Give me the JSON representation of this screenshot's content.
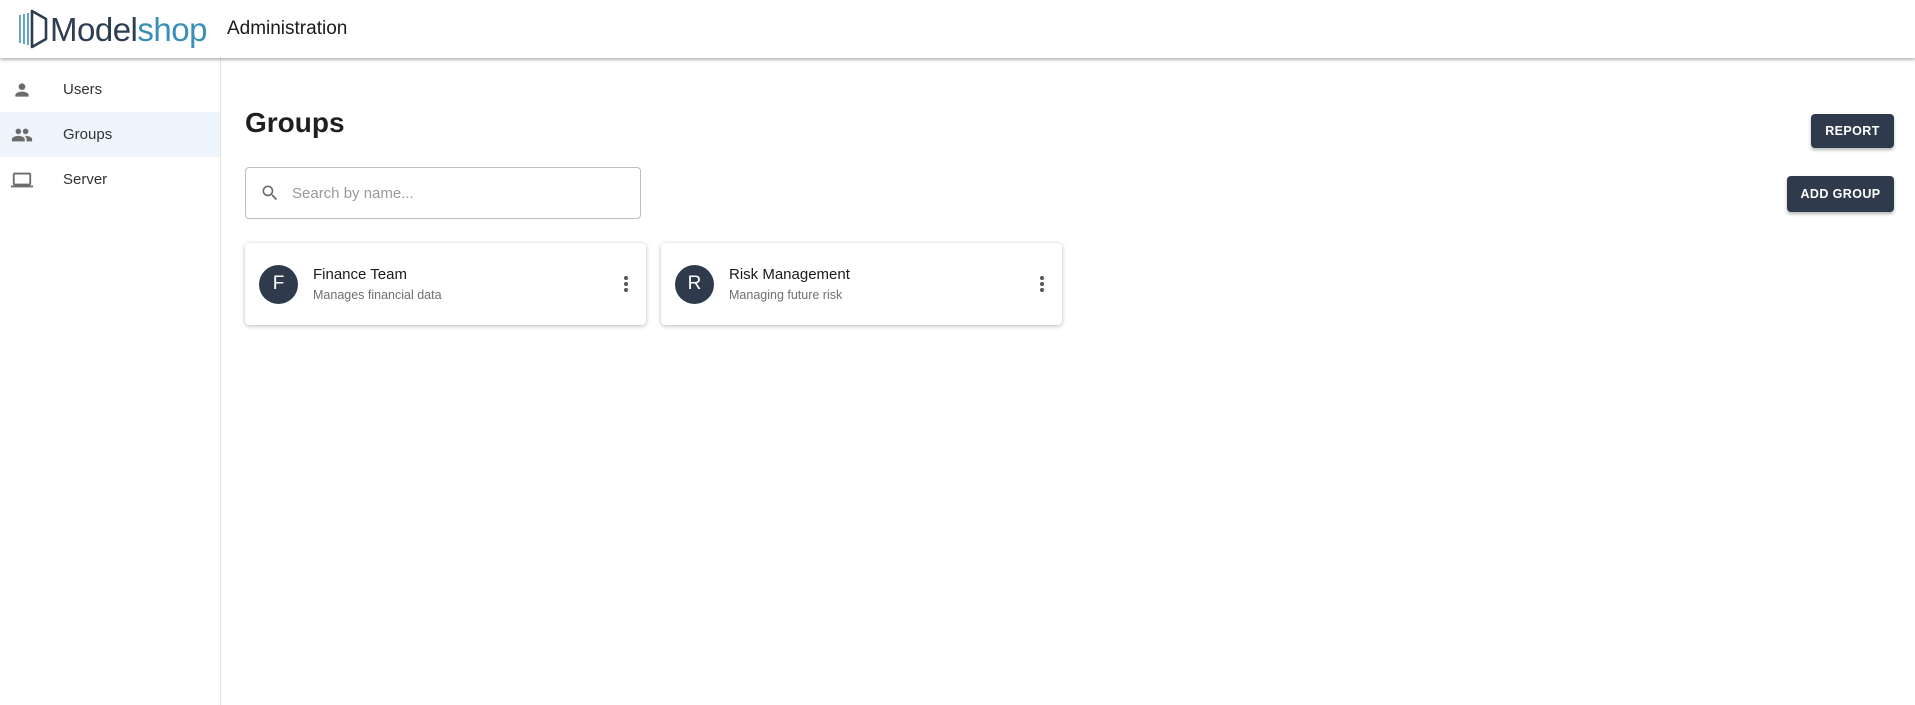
{
  "header": {
    "logo_part1": "Model",
    "logo_part2": "shop",
    "title": "Administration"
  },
  "sidebar": {
    "items": [
      {
        "label": "Users",
        "icon": "person-icon",
        "active": false
      },
      {
        "label": "Groups",
        "icon": "people-icon",
        "active": true
      },
      {
        "label": "Server",
        "icon": "laptop-icon",
        "active": false
      }
    ]
  },
  "main": {
    "title": "Groups",
    "report_label": "REPORT",
    "add_group_label": "ADD GROUP",
    "search": {
      "placeholder": "Search by name...",
      "value": ""
    },
    "groups": [
      {
        "initial": "F",
        "name": "Finance Team",
        "description": "Manages financial data"
      },
      {
        "initial": "R",
        "name": "Risk Management",
        "description": "Managing future risk"
      }
    ]
  },
  "colors": {
    "accent_dark": "#2f3a4d",
    "logo_blue": "#3a8fb7",
    "active_nav_bg": "#eef4fc"
  }
}
